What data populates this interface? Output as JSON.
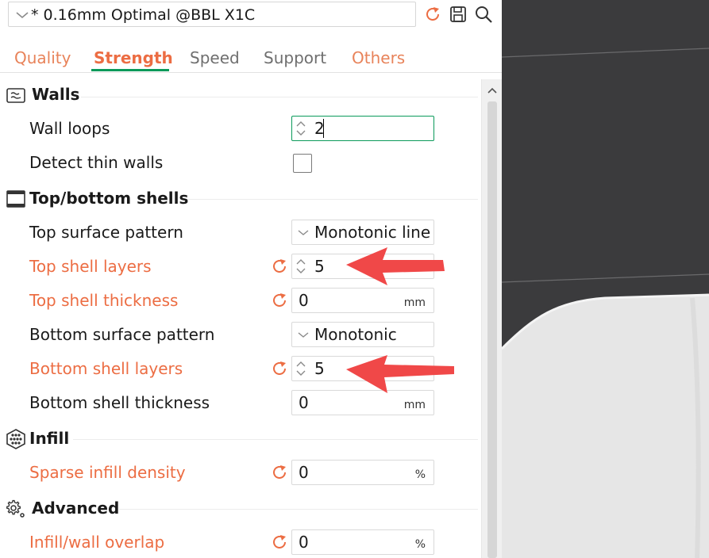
{
  "preset": {
    "name": "* 0.16mm Optimal @BBL X1C"
  },
  "tabs": [
    {
      "label": "Quality"
    },
    {
      "label": "Strength"
    },
    {
      "label": "Speed"
    },
    {
      "label": "Support"
    },
    {
      "label": "Others"
    }
  ],
  "active_tab": "Strength",
  "sections": {
    "walls": {
      "title": "Walls",
      "wall_loops": {
        "label": "Wall loops",
        "value": "2"
      },
      "detect_thin_walls": {
        "label": "Detect thin walls",
        "checked": false
      }
    },
    "shells": {
      "title": "Top/bottom shells",
      "top_surface_pattern": {
        "label": "Top surface pattern",
        "value": "Monotonic line"
      },
      "top_shell_layers": {
        "label": "Top shell layers",
        "value": "5"
      },
      "top_shell_thickness": {
        "label": "Top shell thickness",
        "value": "0",
        "unit": "mm"
      },
      "bottom_surface_pattern": {
        "label": "Bottom surface pattern",
        "value": "Monotonic"
      },
      "bottom_shell_layers": {
        "label": "Bottom shell layers",
        "value": "5"
      },
      "bottom_shell_thickness": {
        "label": "Bottom shell thickness",
        "value": "0",
        "unit": "mm"
      }
    },
    "infill": {
      "title": "Infill",
      "sparse_infill_density": {
        "label": "Sparse infill density",
        "value": "0",
        "unit": "%"
      }
    },
    "advanced": {
      "title": "Advanced",
      "infill_wall_overlap": {
        "label": "Infill/wall overlap",
        "value": "0",
        "unit": "%"
      }
    }
  },
  "icons": {
    "reset": "reset-arrow-icon",
    "save": "floppy-disk-icon",
    "search": "magnifier-icon",
    "annotation": "red-arrow-icon"
  },
  "colors": {
    "accent_orange": "#ec6d43",
    "accent_green": "#0a9a5a",
    "annotation_red": "#f04848",
    "viewport_bg": "#3b3b3d"
  }
}
